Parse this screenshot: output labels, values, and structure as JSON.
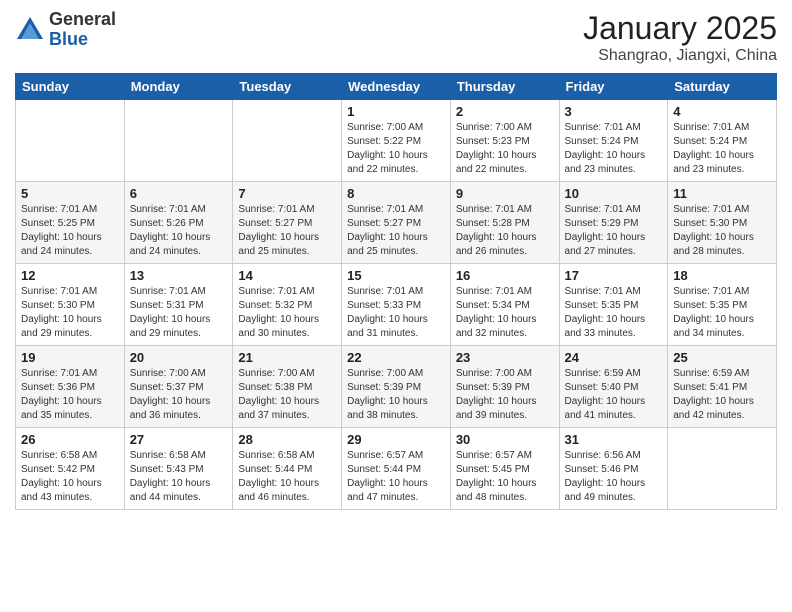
{
  "logo": {
    "general": "General",
    "blue": "Blue"
  },
  "header": {
    "title": "January 2025",
    "subtitle": "Shangrao, Jiangxi, China"
  },
  "weekdays": [
    "Sunday",
    "Monday",
    "Tuesday",
    "Wednesday",
    "Thursday",
    "Friday",
    "Saturday"
  ],
  "weeks": [
    [
      {
        "day": "",
        "info": ""
      },
      {
        "day": "",
        "info": ""
      },
      {
        "day": "",
        "info": ""
      },
      {
        "day": "1",
        "info": "Sunrise: 7:00 AM\nSunset: 5:22 PM\nDaylight: 10 hours\nand 22 minutes."
      },
      {
        "day": "2",
        "info": "Sunrise: 7:00 AM\nSunset: 5:23 PM\nDaylight: 10 hours\nand 22 minutes."
      },
      {
        "day": "3",
        "info": "Sunrise: 7:01 AM\nSunset: 5:24 PM\nDaylight: 10 hours\nand 23 minutes."
      },
      {
        "day": "4",
        "info": "Sunrise: 7:01 AM\nSunset: 5:24 PM\nDaylight: 10 hours\nand 23 minutes."
      }
    ],
    [
      {
        "day": "5",
        "info": "Sunrise: 7:01 AM\nSunset: 5:25 PM\nDaylight: 10 hours\nand 24 minutes."
      },
      {
        "day": "6",
        "info": "Sunrise: 7:01 AM\nSunset: 5:26 PM\nDaylight: 10 hours\nand 24 minutes."
      },
      {
        "day": "7",
        "info": "Sunrise: 7:01 AM\nSunset: 5:27 PM\nDaylight: 10 hours\nand 25 minutes."
      },
      {
        "day": "8",
        "info": "Sunrise: 7:01 AM\nSunset: 5:27 PM\nDaylight: 10 hours\nand 25 minutes."
      },
      {
        "day": "9",
        "info": "Sunrise: 7:01 AM\nSunset: 5:28 PM\nDaylight: 10 hours\nand 26 minutes."
      },
      {
        "day": "10",
        "info": "Sunrise: 7:01 AM\nSunset: 5:29 PM\nDaylight: 10 hours\nand 27 minutes."
      },
      {
        "day": "11",
        "info": "Sunrise: 7:01 AM\nSunset: 5:30 PM\nDaylight: 10 hours\nand 28 minutes."
      }
    ],
    [
      {
        "day": "12",
        "info": "Sunrise: 7:01 AM\nSunset: 5:30 PM\nDaylight: 10 hours\nand 29 minutes."
      },
      {
        "day": "13",
        "info": "Sunrise: 7:01 AM\nSunset: 5:31 PM\nDaylight: 10 hours\nand 29 minutes."
      },
      {
        "day": "14",
        "info": "Sunrise: 7:01 AM\nSunset: 5:32 PM\nDaylight: 10 hours\nand 30 minutes."
      },
      {
        "day": "15",
        "info": "Sunrise: 7:01 AM\nSunset: 5:33 PM\nDaylight: 10 hours\nand 31 minutes."
      },
      {
        "day": "16",
        "info": "Sunrise: 7:01 AM\nSunset: 5:34 PM\nDaylight: 10 hours\nand 32 minutes."
      },
      {
        "day": "17",
        "info": "Sunrise: 7:01 AM\nSunset: 5:35 PM\nDaylight: 10 hours\nand 33 minutes."
      },
      {
        "day": "18",
        "info": "Sunrise: 7:01 AM\nSunset: 5:35 PM\nDaylight: 10 hours\nand 34 minutes."
      }
    ],
    [
      {
        "day": "19",
        "info": "Sunrise: 7:01 AM\nSunset: 5:36 PM\nDaylight: 10 hours\nand 35 minutes."
      },
      {
        "day": "20",
        "info": "Sunrise: 7:00 AM\nSunset: 5:37 PM\nDaylight: 10 hours\nand 36 minutes."
      },
      {
        "day": "21",
        "info": "Sunrise: 7:00 AM\nSunset: 5:38 PM\nDaylight: 10 hours\nand 37 minutes."
      },
      {
        "day": "22",
        "info": "Sunrise: 7:00 AM\nSunset: 5:39 PM\nDaylight: 10 hours\nand 38 minutes."
      },
      {
        "day": "23",
        "info": "Sunrise: 7:00 AM\nSunset: 5:39 PM\nDaylight: 10 hours\nand 39 minutes."
      },
      {
        "day": "24",
        "info": "Sunrise: 6:59 AM\nSunset: 5:40 PM\nDaylight: 10 hours\nand 41 minutes."
      },
      {
        "day": "25",
        "info": "Sunrise: 6:59 AM\nSunset: 5:41 PM\nDaylight: 10 hours\nand 42 minutes."
      }
    ],
    [
      {
        "day": "26",
        "info": "Sunrise: 6:58 AM\nSunset: 5:42 PM\nDaylight: 10 hours\nand 43 minutes."
      },
      {
        "day": "27",
        "info": "Sunrise: 6:58 AM\nSunset: 5:43 PM\nDaylight: 10 hours\nand 44 minutes."
      },
      {
        "day": "28",
        "info": "Sunrise: 6:58 AM\nSunset: 5:44 PM\nDaylight: 10 hours\nand 46 minutes."
      },
      {
        "day": "29",
        "info": "Sunrise: 6:57 AM\nSunset: 5:44 PM\nDaylight: 10 hours\nand 47 minutes."
      },
      {
        "day": "30",
        "info": "Sunrise: 6:57 AM\nSunset: 5:45 PM\nDaylight: 10 hours\nand 48 minutes."
      },
      {
        "day": "31",
        "info": "Sunrise: 6:56 AM\nSunset: 5:46 PM\nDaylight: 10 hours\nand 49 minutes."
      },
      {
        "day": "",
        "info": ""
      }
    ]
  ]
}
